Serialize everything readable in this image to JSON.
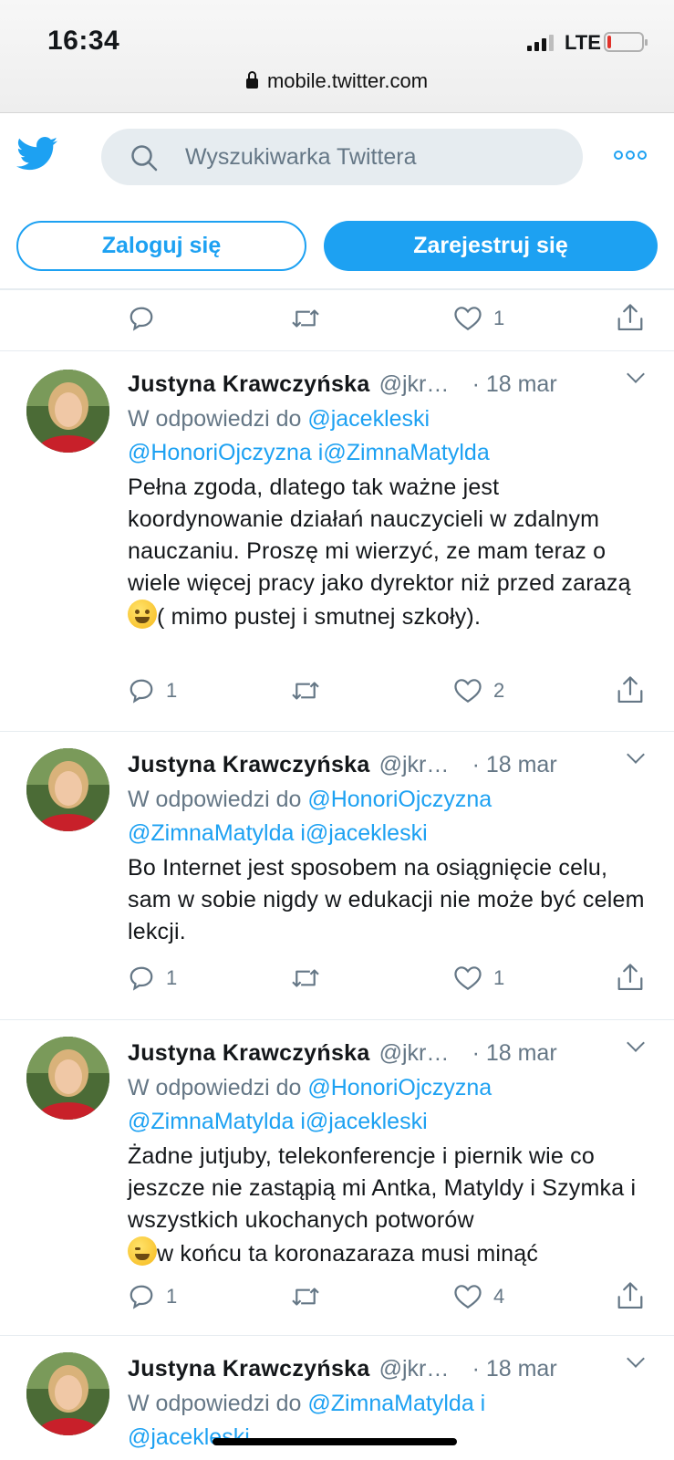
{
  "status": {
    "time": "16:34",
    "network": "LTE",
    "url": "mobile.twitter.com"
  },
  "header": {
    "search_placeholder": "Wyszukiwarka Twittera",
    "login_label": "Zaloguj się",
    "signup_label": "Zarejestruj się"
  },
  "colors": {
    "accent": "#1da1f2",
    "muted": "#657786",
    "text": "#14171a"
  },
  "icons": [
    "twitter-bird-icon",
    "search-icon",
    "more-icon",
    "reply-icon",
    "retweet-icon",
    "like-icon",
    "share-icon"
  ],
  "top_actions": {
    "replies": "",
    "likes": "1"
  },
  "tweets": [
    {
      "author": "Justyna Krawczyńska",
      "handle": "@jkr…",
      "date": "· 18 mar",
      "reply_prefix": "W odpowiedzi do",
      "mention_1": "@jacekleski",
      "mention_2": "@HonoriOjczyzna",
      "mention_join": "i",
      "mention_3": "@ZimnaMatylda",
      "text_a": "Pełna zgoda, dlatego tak ważne jest koordynowanie działań nauczycieli w zdalnym nauczaniu. Proszę mi wierzyć, ze mam teraz o wiele więcej pracy jako dyrektor niż przed zarazą",
      "text_b": "( mimo pustej i smutnej szkoły).",
      "replies": "1",
      "likes": "2"
    },
    {
      "author": "Justyna Krawczyńska",
      "handle": "@jkr…",
      "date": "· 18 mar",
      "reply_prefix": "W odpowiedzi do",
      "mention_1": "@HonoriOjczyzna",
      "mention_2": "@ZimnaMatylda",
      "mention_join": "i",
      "mention_3": "@jacekleski",
      "text_a": "Bo Internet jest sposobem na osiągnięcie celu, sam w sobie nigdy w edukacji nie może być celem lekcji.",
      "replies": "1",
      "likes": "1"
    },
    {
      "author": "Justyna Krawczyńska",
      "handle": "@jkr…",
      "date": "· 18 mar",
      "reply_prefix": "W odpowiedzi do",
      "mention_1": "@HonoriOjczyzna",
      "mention_2": "@ZimnaMatylda",
      "mention_join": "i",
      "mention_3": "@jacekleski",
      "text_a": "Żadne jutjuby, telekonferencje i piernik wie co jeszcze nie zastąpią mi Antka, Matyldy i Szymka i wszystkich ukochanych potworów",
      "text_b": "w końcu ta koronazaraza musi minąć",
      "replies": "1",
      "likes": "4"
    },
    {
      "author": "Justyna Krawczyńska",
      "handle": "@jkr…",
      "date": "· 18 mar",
      "reply_prefix": "W odpowiedzi do",
      "mention_1": "@ZimnaMatylda",
      "mention_join": "i",
      "mention_2": "@jacekleski"
    }
  ]
}
